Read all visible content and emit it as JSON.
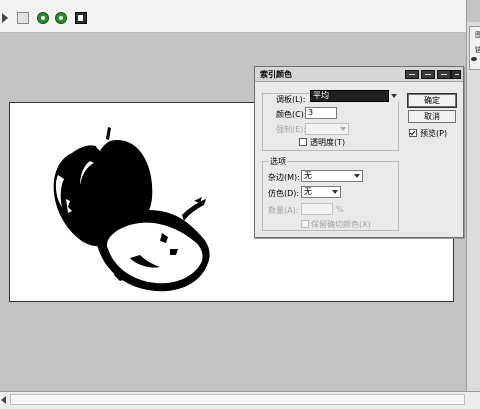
{
  "toolbar": {
    "icons": [
      "arrow-icon",
      "green-circle-icon",
      "green-circle-icon",
      "paste-icon"
    ]
  },
  "right_panel": {
    "tab1": "图",
    "tab2": "链"
  },
  "dialog": {
    "title": "索引颜色",
    "palette_label": "调板(L):",
    "palette_value": "平均",
    "colors_label": "颜色(C):",
    "colors_value": "3",
    "forced_label": "强制(E):",
    "transparency_label": "透明度(T)",
    "options_group": "选项",
    "matte_label": "杂边(M):",
    "matte_value": "无",
    "dither_label": "仿色(D):",
    "dither_value": "无",
    "amount_label": "数量(A):",
    "amount_unit": "%",
    "preserve_label": "保留确切颜色(X)",
    "ok_label": "确定",
    "cancel_label": "取消",
    "preview_label": "预览(P)",
    "preview_checked": true
  },
  "colors": {
    "workspace": "#c4c4c4",
    "dialog_bg": "#e9e9e9",
    "palette_select_bg": "#1f1f1f"
  }
}
